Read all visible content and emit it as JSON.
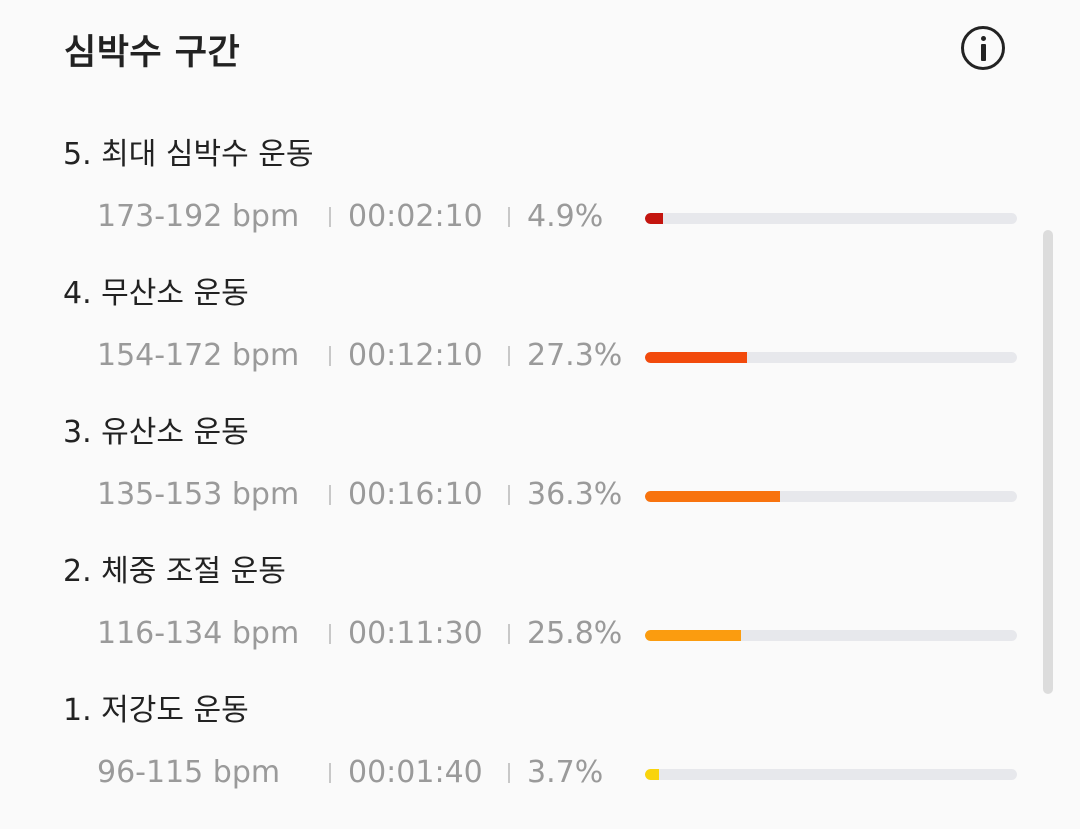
{
  "header": {
    "title": "심박수 구간",
    "info_icon": "info-icon"
  },
  "zones": [
    {
      "name": "5. 최대 심박수 운동",
      "bpm": "173-192 bpm",
      "time": "00:02:10",
      "percent": "4.9%",
      "fraction": 0.049,
      "color": "#c4150f"
    },
    {
      "name": "4. 무산소 운동",
      "bpm": "154-172 bpm",
      "time": "00:12:10",
      "percent": "27.3%",
      "fraction": 0.273,
      "color": "#f24a0c"
    },
    {
      "name": "3. 유산소 운동",
      "bpm": "135-153 bpm",
      "time": "00:16:10",
      "percent": "36.3%",
      "fraction": 0.363,
      "color": "#f8730e"
    },
    {
      "name": "2. 체중 조절 운동",
      "bpm": "116-134 bpm",
      "time": "00:11:30",
      "percent": "25.8%",
      "fraction": 0.258,
      "color": "#fb9c0f"
    },
    {
      "name": "1. 저강도 운동",
      "bpm": "96-115 bpm",
      "time": "00:01:40",
      "percent": "3.7%",
      "fraction": 0.037,
      "color": "#f9d40c"
    }
  ]
}
